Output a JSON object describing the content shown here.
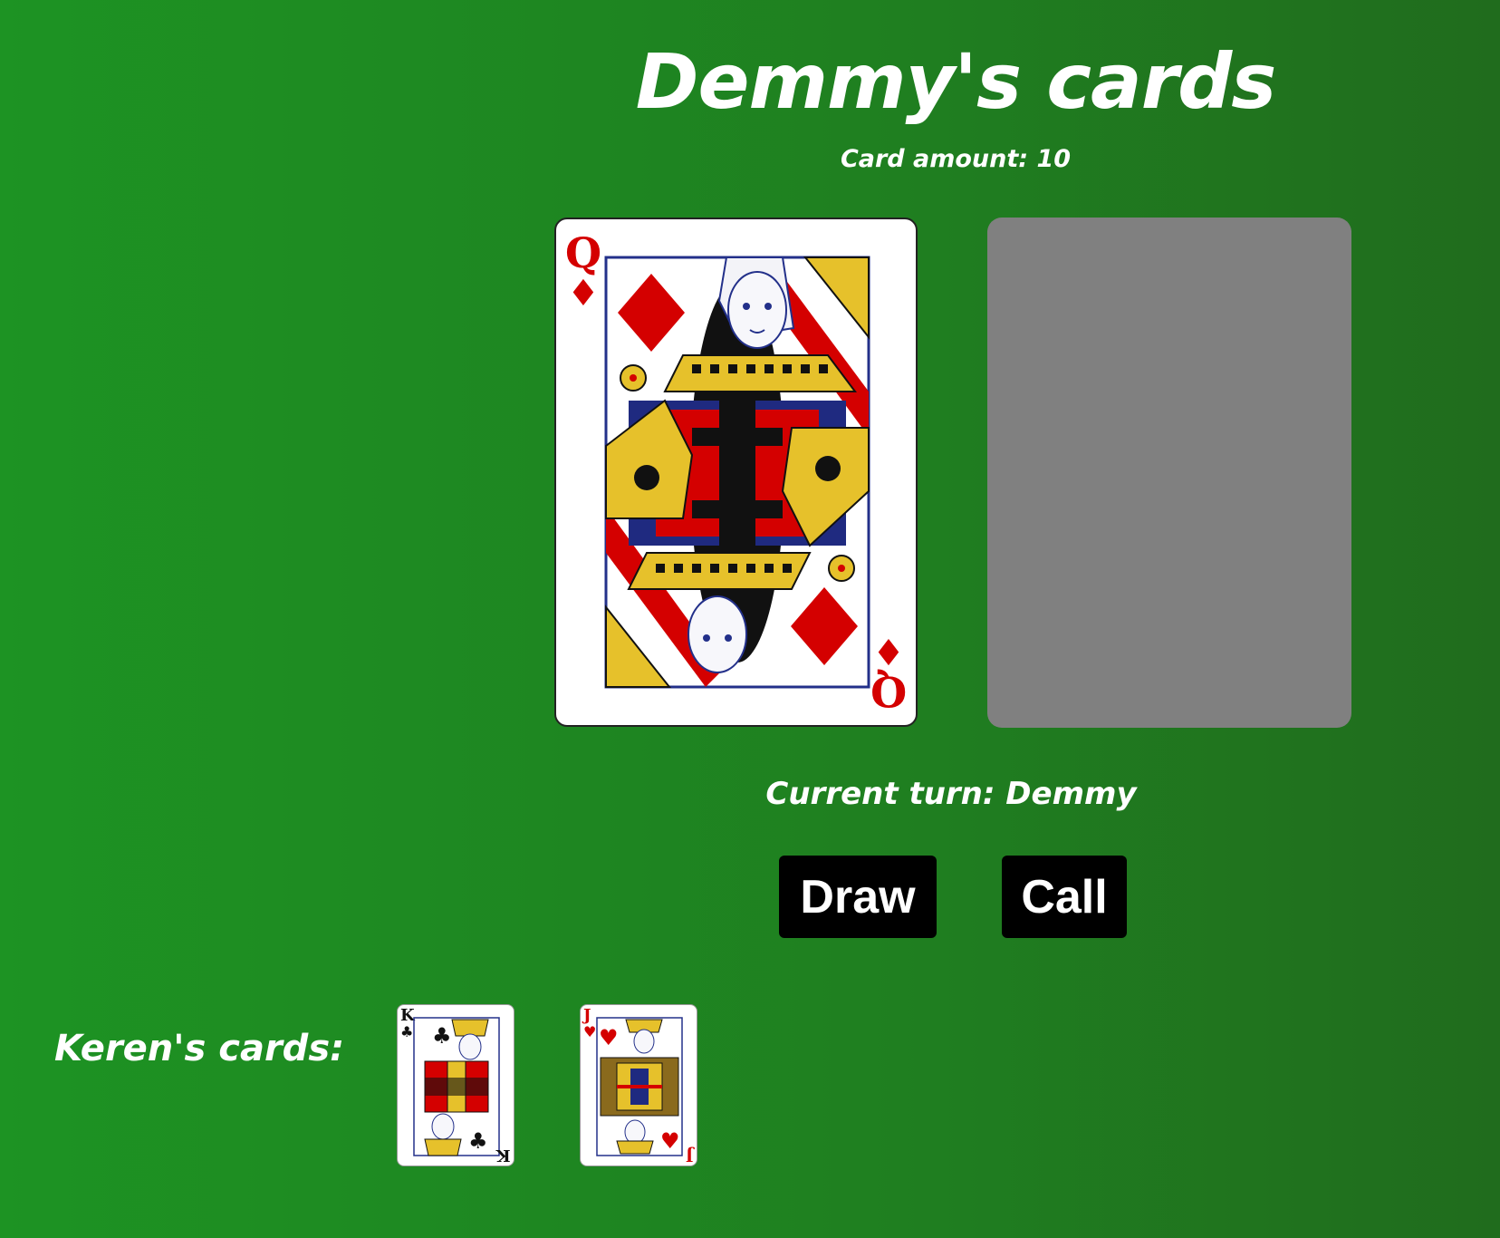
{
  "header": {
    "title": "Demmy's cards",
    "card_amount": "Card amount: 10"
  },
  "table": {
    "face_up_card": {
      "rank": "Q",
      "suit": "♦",
      "color": "#d40000"
    },
    "deck_color": "#808080"
  },
  "status": {
    "current_turn": "Current turn: Demmy"
  },
  "actions": {
    "draw_label": "Draw",
    "call_label": "Call"
  },
  "opponent": {
    "label": "Keren's cards:",
    "cards": [
      {
        "rank": "K",
        "suit": "♣"
      },
      {
        "rank": "J",
        "suit": "♥"
      }
    ]
  },
  "colors": {
    "background": "#1f8521",
    "button_bg": "#000000",
    "button_text": "#ffffff"
  }
}
